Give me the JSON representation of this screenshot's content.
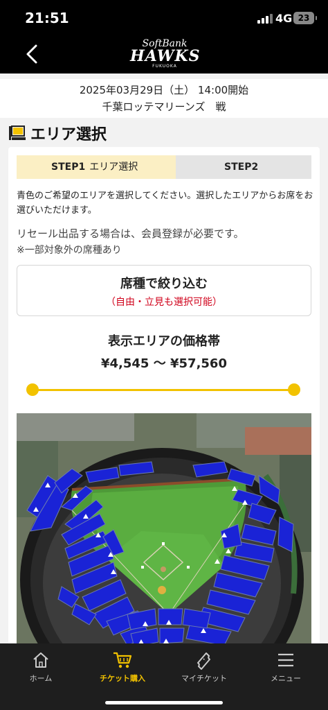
{
  "status": {
    "time": "21:51",
    "network": "4G",
    "battery": "23"
  },
  "header": {
    "logo_line1": "SoftBank",
    "logo_line2": "HAWKS",
    "logo_line3": "FUKUOKA"
  },
  "game": {
    "datetime": "2025年03月29日（土） 14:00開始",
    "opponent": "千葉ロッテマリーンズ　戦"
  },
  "section_title": "エリア選択",
  "steps": [
    {
      "step": "STEP1",
      "label": "エリア選択",
      "active": true
    },
    {
      "step": "STEP2",
      "label": "",
      "active": false
    }
  ],
  "description": "青色のご希望のエリアを選択してください。選択したエリアからお席をお選びいただけます。",
  "resale_note": "リセール出品する場合は、会員登録が必要です。",
  "exclusion_note": "※一部対象外の席種あり",
  "filter": {
    "title": "席種で絞り込む",
    "subtitle": "（自由・立見も選択可能）"
  },
  "price": {
    "title": "表示エリアの価格帯",
    "range": "¥4,545 〜 ¥57,560",
    "slider_min": 0,
    "slider_max": 1
  },
  "tabs": [
    {
      "label": "ホーム",
      "icon": "home-icon",
      "active": false
    },
    {
      "label": "チケット購入",
      "icon": "cart-icon",
      "active": true
    },
    {
      "label": "マイチケット",
      "icon": "ticket-icon",
      "active": false
    },
    {
      "label": "メニュー",
      "icon": "menu-icon",
      "active": false
    }
  ],
  "colors": {
    "accent": "#f2c200",
    "seat_available": "#1a23d6",
    "alert": "#d0021b"
  }
}
